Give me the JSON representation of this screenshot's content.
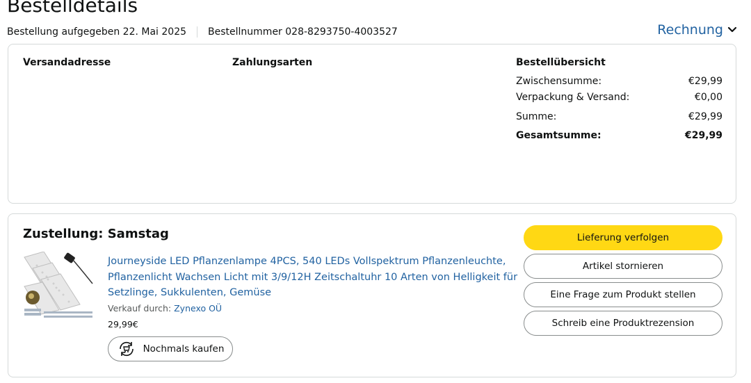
{
  "header": {
    "title": "Bestelldetails",
    "order_placed": "Bestellung aufgegeben 22. Mai 2025",
    "order_number": "Bestellnummer 028-8293750-4003527",
    "invoice_label": "Rechnung",
    "invoice_icon": "chevron-down-icon"
  },
  "summary_card": {
    "shipping_address_heading": "Versandadresse",
    "payment_methods_heading": "Zahlungsarten",
    "order_summary_heading": "Bestellübersicht",
    "rows": [
      {
        "label": "Zwischensumme:",
        "value": "€29,99"
      },
      {
        "label": "Verpackung & Versand:",
        "value": "€0,00"
      },
      {
        "label": "Summe:",
        "value": "€29,99"
      },
      {
        "label": "Gesamtsumme:",
        "value": "€29,99"
      }
    ]
  },
  "delivery_card": {
    "title": "Zustellung: Samstag",
    "product": {
      "title": "Journeyside LED Pflanzenlampe 4PCS, 540 LEDs Vollspektrum Pflanzenleuchte, Pflanzenlicht Wachsen Licht mit 3/9/12H Zeitschaltuhr 10 Arten von Helligkeit für Setzlinge, Sukkulenten, Gemüse",
      "sold_by_label": "Verkauf durch:",
      "seller": "Zynexo OÜ",
      "price": "29,99€",
      "image_icon": "led-grow-light-product-image"
    },
    "buy_again_label": "Nochmals kaufen",
    "buy_again_icon": "buy-again-icon",
    "actions": {
      "track": "Lieferung verfolgen",
      "cancel": "Artikel stornieren",
      "question": "Eine Frage zum Produkt stellen",
      "review": "Schreib eine Produktrezension"
    }
  },
  "colors": {
    "link": "#2162a1",
    "primary_button": "#ffd814",
    "border": "#d5d9d9",
    "text": "#0f1111",
    "secondary_text": "#565959"
  }
}
